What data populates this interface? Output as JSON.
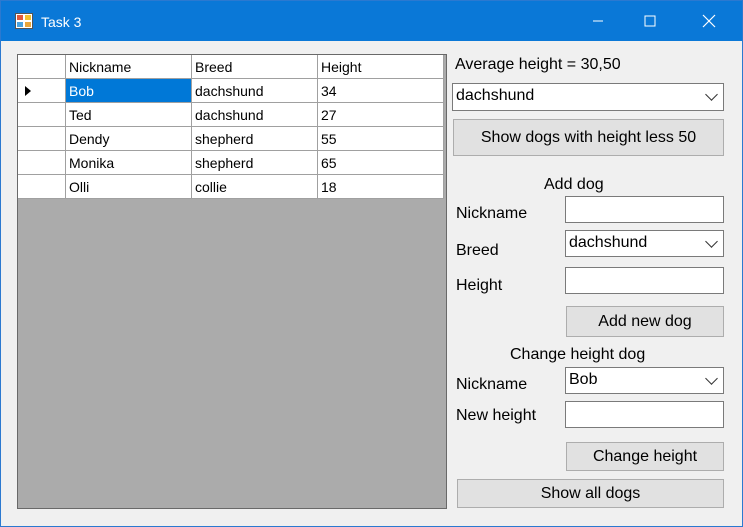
{
  "window": {
    "title": "Task 3"
  },
  "grid": {
    "columns": [
      "Nickname",
      "Breed",
      "Height"
    ],
    "rows": [
      {
        "nickname": "Bob",
        "breed": "dachshund",
        "height": "34"
      },
      {
        "nickname": "Ted",
        "breed": "dachshund",
        "height": "27"
      },
      {
        "nickname": "Dendy",
        "breed": "shepherd",
        "height": "55"
      },
      {
        "nickname": "Monika",
        "breed": "shepherd",
        "height": "65"
      },
      {
        "nickname": "Olli",
        "breed": "collie",
        "height": "18"
      }
    ]
  },
  "summary": {
    "average_label": "Average height = 30,50",
    "breed_filter_value": "dachshund",
    "show_less_button": "Show dogs with height less 50"
  },
  "add_dog": {
    "heading": "Add dog",
    "nickname_label": "Nickname",
    "nickname_value": "",
    "breed_label": "Breed",
    "breed_value": "dachshund",
    "height_label": "Height",
    "height_value": "",
    "add_button": "Add new dog"
  },
  "change_height": {
    "heading": "Change height dog",
    "nickname_label": "Nickname",
    "nickname_value": "Bob",
    "new_height_label": "New height",
    "new_height_value": "",
    "change_button": "Change height"
  },
  "show_all_button": "Show all dogs",
  "colors": {
    "titlebar": "#0a78d7",
    "selection": "#0078d7",
    "grid_empty": "#ababab"
  }
}
